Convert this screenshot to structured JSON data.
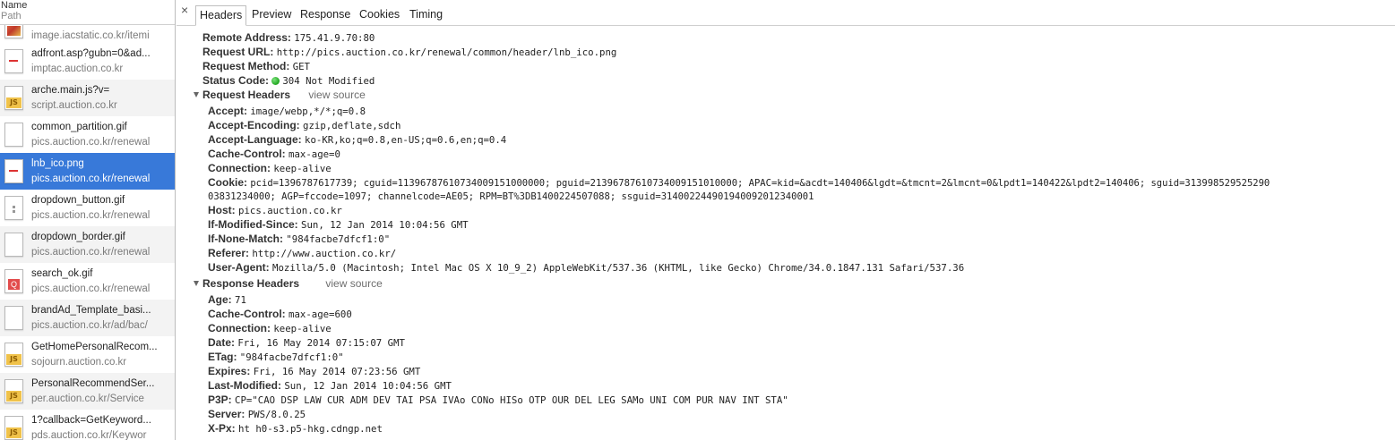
{
  "list": {
    "header_name": "Name",
    "header_path": "Path",
    "rows": [
      {
        "name": "",
        "path": "image.iacstatic.co.kr/itemi",
        "icon": "image-thumb-icon"
      },
      {
        "name": "adfront.asp?gubn=0&ad...",
        "path": "imptac.auction.co.kr",
        "icon": "document-icon"
      },
      {
        "name": "arche.main.js?v=",
        "path": "script.auction.co.kr",
        "icon": "js-file-icon"
      },
      {
        "name": "common_partition.gif",
        "path": "pics.auction.co.kr/renewal",
        "icon": "image-file-icon"
      },
      {
        "name": "lnb_ico.png",
        "path": "pics.auction.co.kr/renewal",
        "icon": "image-file-icon"
      },
      {
        "name": "dropdown_button.gif",
        "path": "pics.auction.co.kr/renewal",
        "icon": "image-file-icon"
      },
      {
        "name": "dropdown_border.gif",
        "path": "pics.auction.co.kr/renewal",
        "icon": "image-file-icon"
      },
      {
        "name": "search_ok.gif",
        "path": "pics.auction.co.kr/renewal",
        "icon": "search-image-icon"
      },
      {
        "name": "brandAd_Template_basi...",
        "path": "pics.auction.co.kr/ad/bac/",
        "icon": "image-file-icon"
      },
      {
        "name": "GetHomePersonalRecom...",
        "path": "sojourn.auction.co.kr",
        "icon": "js-file-icon"
      },
      {
        "name": "PersonalRecommendSer...",
        "path": "per.auction.co.kr/Service",
        "icon": "js-file-icon"
      },
      {
        "name": "1?callback=GetKeyword...",
        "path": "pds.auction.co.kr/Keywor",
        "icon": "js-file-icon"
      }
    ]
  },
  "tabs": [
    "Headers",
    "Preview",
    "Response",
    "Cookies",
    "Timing"
  ],
  "close_label": "×",
  "general": [
    {
      "key": "Remote Address:",
      "value": "175.41.9.70:80"
    },
    {
      "key": "Request URL:",
      "value": "http://pics.auction.co.kr/renewal/common/header/lnb_ico.png"
    },
    {
      "key": "Request Method:",
      "value": "GET"
    },
    {
      "key": "Status Code:",
      "value": "304 Not Modified"
    }
  ],
  "request_headers": {
    "title": "Request Headers",
    "view_source": "view source",
    "items": [
      {
        "key": "Accept:",
        "value": "image/webp,*/*;q=0.8"
      },
      {
        "key": "Accept-Encoding:",
        "value": "gzip,deflate,sdch"
      },
      {
        "key": "Accept-Language:",
        "value": "ko-KR,ko;q=0.8,en-US;q=0.6,en;q=0.4"
      },
      {
        "key": "Cache-Control:",
        "value": "max-age=0"
      },
      {
        "key": "Connection:",
        "value": "keep-alive"
      },
      {
        "key": "Cookie:",
        "value": "pcid=1396787617739; cguid=11396787610734009151000000; pguid=21396787610734009151010000; APAC=kid=&acdt=140406&lgdt=&tmcnt=2&lmcnt=0&lpdt1=140422&lpdt2=140406; sguid=313998529525290",
        "cont": "03831234000; AGP=fccode=1097; channelcode=AE05; RPM=BT%3DB1400224507088; ssguid=314002244901940092012340001"
      },
      {
        "key": "Host:",
        "value": "pics.auction.co.kr"
      },
      {
        "key": "If-Modified-Since:",
        "value": "Sun, 12 Jan 2014 10:04:56 GMT"
      },
      {
        "key": "If-None-Match:",
        "value": "\"984facbe7dfcf1:0\""
      },
      {
        "key": "Referer:",
        "value": "http://www.auction.co.kr/"
      },
      {
        "key": "User-Agent:",
        "value": "Mozilla/5.0 (Macintosh; Intel Mac OS X 10_9_2) AppleWebKit/537.36 (KHTML, like Gecko) Chrome/34.0.1847.131 Safari/537.36"
      }
    ]
  },
  "response_headers": {
    "title": "Response Headers",
    "view_source": "view source",
    "items": [
      {
        "key": "Age:",
        "value": "71"
      },
      {
        "key": "Cache-Control:",
        "value": "max-age=600"
      },
      {
        "key": "Connection:",
        "value": "keep-alive"
      },
      {
        "key": "Date:",
        "value": "Fri, 16 May 2014 07:15:07 GMT"
      },
      {
        "key": "ETag:",
        "value": "\"984facbe7dfcf1:0\""
      },
      {
        "key": "Expires:",
        "value": "Fri, 16 May 2014 07:23:56 GMT"
      },
      {
        "key": "Last-Modified:",
        "value": "Sun, 12 Jan 2014 10:04:56 GMT"
      },
      {
        "key": "P3P:",
        "value": "CP=\"CAO DSP LAW CUR ADM DEV TAI PSA IVAo CONo HISo OTP OUR DEL LEG SAMo UNI COM PUR NAV INT STA\""
      },
      {
        "key": "Server:",
        "value": "PWS/8.0.25"
      },
      {
        "key": "X-Px:",
        "value": "ht h0-s3.p5-hkg.cdngp.net"
      }
    ]
  },
  "colors": {
    "selected_row": "#3879d9",
    "status_ok": "#1fa61f"
  }
}
